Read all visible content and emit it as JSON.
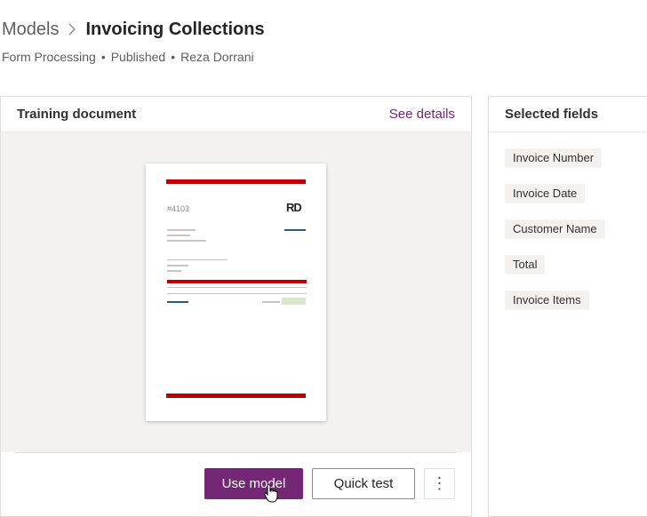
{
  "breadcrumb": {
    "root": "Models",
    "current": "Invoicing Collections"
  },
  "meta": {
    "type": "Form Processing",
    "status": "Published",
    "owner": "Reza Dorrani"
  },
  "training": {
    "title": "Training document",
    "link": "See details",
    "doc": {
      "invoice_no": "#4103",
      "logo": "RD"
    }
  },
  "actions": {
    "use_model": "Use model",
    "quick_test": "Quick test",
    "more": "⋮"
  },
  "fields_panel": {
    "title": "Selected fields",
    "items": [
      "Invoice Number",
      "Invoice Date",
      "Customer Name",
      "Total",
      "Invoice Items"
    ]
  },
  "colors": {
    "accent": "#742774",
    "doc_red": "#c00000"
  }
}
